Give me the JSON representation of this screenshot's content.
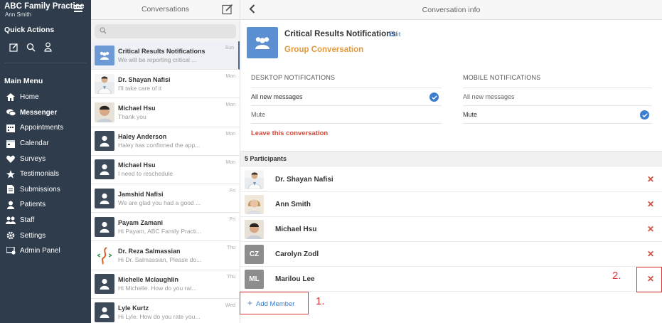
{
  "sidebar": {
    "practice_name": "ABC Family Practice",
    "user_name": "Ann Smith",
    "quick_actions_title": "Quick Actions",
    "quick_actions": [
      {
        "icon": "compose-icon"
      },
      {
        "icon": "search-icon"
      },
      {
        "icon": "user-add-icon"
      }
    ],
    "main_menu_title": "Main Menu",
    "menu": [
      {
        "label": "Home",
        "icon": "home-icon"
      },
      {
        "label": "Messenger",
        "icon": "chat-icon",
        "active": true
      },
      {
        "label": "Appointments",
        "icon": "appointments-icon"
      },
      {
        "label": "Calendar",
        "icon": "calendar-icon"
      },
      {
        "label": "Surveys",
        "icon": "heart-icon"
      },
      {
        "label": "Testimonials",
        "icon": "star-icon"
      },
      {
        "label": "Submissions",
        "icon": "document-icon"
      },
      {
        "label": "Patients",
        "icon": "patients-icon"
      },
      {
        "label": "Staff",
        "icon": "staff-icon"
      },
      {
        "label": "Settings",
        "icon": "gear-icon"
      },
      {
        "label": "Admin Panel",
        "icon": "admin-icon"
      }
    ]
  },
  "conversations": {
    "title": "Conversations",
    "items": [
      {
        "name": "Critical Results Notifications",
        "preview": "We will be reporting critical ...",
        "day": "Sun",
        "avatar": "group"
      },
      {
        "name": "Dr. Shayan Nafisi",
        "preview": "I'll take care of it",
        "day": "Mon",
        "avatar": "doctor"
      },
      {
        "name": "Michael Hsu",
        "preview": "Thank you",
        "day": "Mon",
        "avatar": "photo-man"
      },
      {
        "name": "Haley Anderson",
        "preview": "Haley has confirmed the app...",
        "day": "Mon",
        "avatar": "placeholder"
      },
      {
        "name": "Michael Hsu",
        "preview": "I need to reschedule",
        "day": "Mon",
        "avatar": "placeholder"
      },
      {
        "name": "Jamshid Nafisi",
        "preview": "We are glad you had a good ...",
        "day": "Fri",
        "avatar": "placeholder"
      },
      {
        "name": "Payam Zamani",
        "preview": "Hi Payam, ABC Family Practi...",
        "day": "Fri",
        "avatar": "placeholder"
      },
      {
        "name": "Dr. Reza Salmassian",
        "preview": "Hi Dr. Salmassian, Please do...",
        "day": "Thu",
        "avatar": "logo"
      },
      {
        "name": "Michelle Mclaughlin",
        "preview": "Hi Michelle. How do you rat...",
        "day": "Thu",
        "avatar": "placeholder"
      },
      {
        "name": "Lyle Kurtz",
        "preview": "Hi Lyle. How do you rate you...",
        "day": "Wed",
        "avatar": "placeholder"
      }
    ]
  },
  "info": {
    "title": "Conversation info",
    "group_name": "Critical Results Notifications",
    "edit_label": "Edit",
    "group_type": "Group Conversation",
    "desktop": {
      "heading": "DESKTOP NOTIFICATIONS",
      "options": [
        {
          "label": "All new messages",
          "selected": true
        },
        {
          "label": "Mute",
          "selected": false
        }
      ],
      "leave_label": "Leave this conversation"
    },
    "mobile": {
      "heading": "MOBILE NOTIFICATIONS",
      "options": [
        {
          "label": "All new messages",
          "selected": false
        },
        {
          "label": "Mute",
          "selected": true
        }
      ]
    },
    "participants_heading": "5 Participants",
    "participants": [
      {
        "name": "Dr. Shayan Nafisi",
        "avatar": "doctor",
        "initials": ""
      },
      {
        "name": "Ann Smith",
        "avatar": "photo-woman",
        "initials": ""
      },
      {
        "name": "Michael Hsu",
        "avatar": "photo-man",
        "initials": ""
      },
      {
        "name": "Carolyn Zodl",
        "avatar": "initials",
        "initials": "CZ"
      },
      {
        "name": "Marilou Lee",
        "avatar": "initials",
        "initials": "ML"
      }
    ],
    "remove_symbol": "✕",
    "add_member_label": "Add Member"
  },
  "annotations": {
    "label_1": "1.",
    "label_2": "2.",
    "color": "#dd3333"
  },
  "colors": {
    "sidebar_bg": "#2f3c4b",
    "accent_blue": "#3c7dd0",
    "group_orange": "#e49a3a",
    "danger_red": "#d04c3c"
  }
}
